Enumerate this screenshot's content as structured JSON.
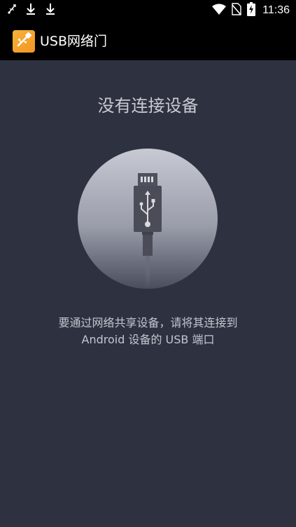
{
  "status_bar": {
    "time": "11:36",
    "icons": [
      "usb-debug-icon",
      "download-icon",
      "download-icon",
      "wifi-icon",
      "no-sim-icon",
      "battery-charging-icon"
    ]
  },
  "app_bar": {
    "title": "USB网络门",
    "icon": "usb-cable-icon"
  },
  "main": {
    "heading": "没有连接设备",
    "illustration": "usb-cable-icon",
    "message_line1": "要通过网络共享设备，请将其连接到",
    "message_line2": "Android 设备的 USB 端口"
  },
  "colors": {
    "background": "#2e3140",
    "bar": "#000000",
    "accent": "#f39423"
  }
}
